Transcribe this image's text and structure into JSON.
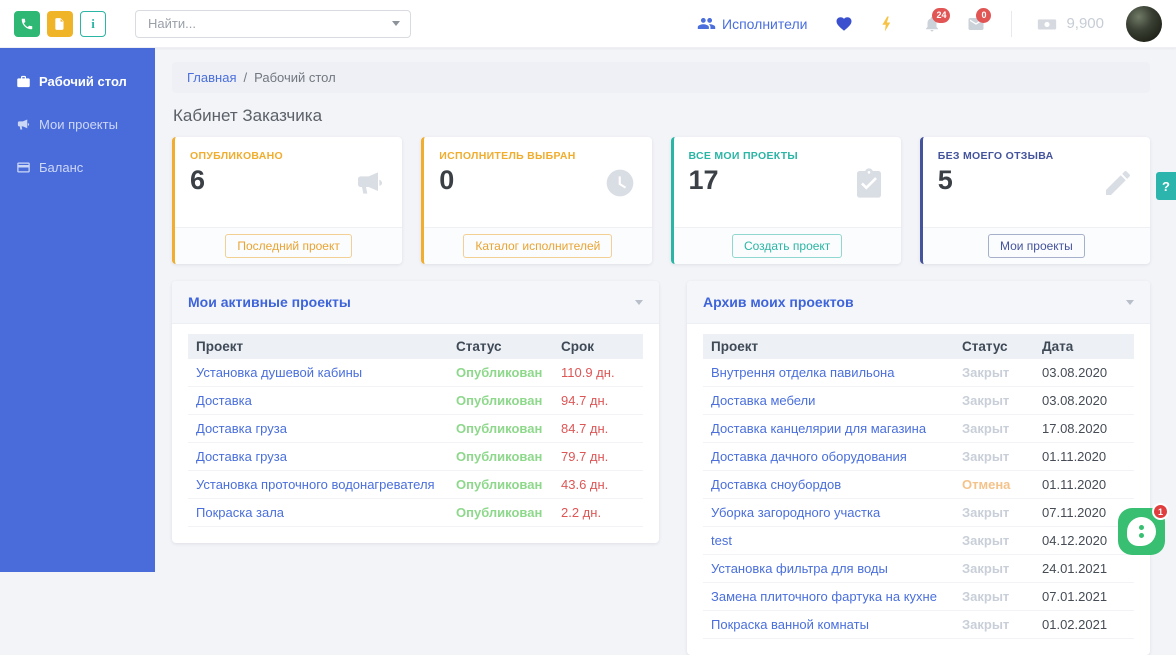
{
  "colors": {
    "sidebar_bg": "#4a6cda",
    "link_blue": "#4a6fdc",
    "term_red": "#dd5656",
    "badge_red": "#e25555",
    "chat_green": "#38bf71",
    "help_teal": "#2cb5ad",
    "status_colors": {
      "Опубликован": "#8ed88b",
      "Закрыт": "#c9cfd8",
      "Отмена": "#f4c38b"
    }
  },
  "header": {
    "quick_buttons": {
      "info_label": "i"
    },
    "search_placeholder": "Найти...",
    "executors_label": "Исполнители",
    "notifications_badge": "24",
    "messages_badge": "0",
    "balance": "9,900"
  },
  "sidebar": {
    "items": [
      {
        "label": "Рабочий стол",
        "icon": "briefcase-icon",
        "active": true
      },
      {
        "label": "Мои проекты",
        "icon": "megaphone-icon",
        "active": false
      },
      {
        "label": "Баланс",
        "icon": "wallet-icon",
        "active": false
      }
    ]
  },
  "breadcrumb": {
    "home": "Главная",
    "separator": "/",
    "current": "Рабочий стол"
  },
  "page_title": "Кабинет Заказчика",
  "stat_cards": [
    {
      "label": "ОПУБЛИКОВАНО",
      "value": "6",
      "icon": "megaphone-icon",
      "button": "Последний проект",
      "accent": "#f0ad2e"
    },
    {
      "label": "ИСПОЛНИТЕЛЬ ВЫБРАН",
      "value": "0",
      "icon": "clock-icon",
      "button": "Каталог исполнителей",
      "accent": "#f0ad2e"
    },
    {
      "label": "ВСЕ МОИ ПРОЕКТЫ",
      "value": "17",
      "icon": "clipboard-check-icon",
      "button": "Создать проект",
      "accent": "#2ab5a5"
    },
    {
      "label": "БЕЗ МОЕГО ОТЗЫВА",
      "value": "5",
      "icon": "pencil-icon",
      "button": "Мои проекты",
      "accent": "#44549c"
    }
  ],
  "active_projects": {
    "title": "Мои активные проекты",
    "columns": [
      "Проект",
      "Статус",
      "Срок"
    ],
    "rows": [
      {
        "name": "Установка душевой кабины",
        "status": "Опубликован",
        "value": "110.9 дн."
      },
      {
        "name": "Доставка",
        "status": "Опубликован",
        "value": "94.7 дн."
      },
      {
        "name": "Доставка груза",
        "status": "Опубликован",
        "value": "84.7 дн."
      },
      {
        "name": "Доставка груза",
        "status": "Опубликован",
        "value": "79.7 дн."
      },
      {
        "name": "Установка проточного водонагревателя",
        "status": "Опубликован",
        "value": "43.6 дн."
      },
      {
        "name": "Покраска зала",
        "status": "Опубликован",
        "value": "2.2 дн."
      }
    ]
  },
  "archive_projects": {
    "title": "Архив моих проектов",
    "columns": [
      "Проект",
      "Статус",
      "Дата"
    ],
    "rows": [
      {
        "name": "Внутрення отделка павильона",
        "status": "Закрыт",
        "value": "03.08.2020"
      },
      {
        "name": "Доставка мебели",
        "status": "Закрыт",
        "value": "03.08.2020"
      },
      {
        "name": "Доставка канцелярии для магазина",
        "status": "Закрыт",
        "value": "17.08.2020"
      },
      {
        "name": "Доставка дачного оборудования",
        "status": "Закрыт",
        "value": "01.11.2020"
      },
      {
        "name": "Доставка сноубордов",
        "status": "Отмена",
        "value": "01.11.2020"
      },
      {
        "name": "Уборка загородного участка",
        "status": "Закрыт",
        "value": "07.11.2020"
      },
      {
        "name": "test",
        "status": "Закрыт",
        "value": "04.12.2020"
      },
      {
        "name": "Установка фильтра для воды",
        "status": "Закрыт",
        "value": "24.01.2021"
      },
      {
        "name": "Замена плиточного фартука на кухне",
        "status": "Закрыт",
        "value": "07.01.2021"
      },
      {
        "name": "Покраска ванной комнаты",
        "status": "Закрыт",
        "value": "01.02.2021"
      }
    ]
  },
  "help_tab": "?",
  "chat_badge": "1"
}
